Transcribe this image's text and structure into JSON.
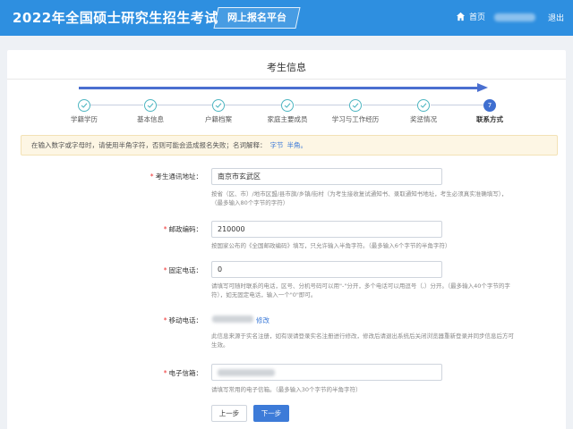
{
  "header": {
    "title": "2022年全国硕士研究生招生考试",
    "platform": "网上报名平台",
    "home": "首页",
    "logout": "退出"
  },
  "page_title": "考生信息",
  "steps": [
    {
      "label": "学籍学历"
    },
    {
      "label": "基本信息"
    },
    {
      "label": "户籍档案"
    },
    {
      "label": "家庭主要成员"
    },
    {
      "label": "学习与工作经历"
    },
    {
      "label": "奖惩情况"
    },
    {
      "label": "联系方式",
      "number": "7"
    }
  ],
  "notice": {
    "text": "在输入数字或字母时，请使用半角字符，否则可能会造成报名失败；名词解释：",
    "link1": "字节",
    "link2": "半角。"
  },
  "fields": {
    "address": {
      "label": "考生通讯地址：",
      "value": "南京市玄武区",
      "hint": "按省（区、市）/地市区盟/县市旗/乡镇/街村（为考生接收复试通知书、录取通知书地址，考生必须真实准确填写），（最多输入80个字节的字符）"
    },
    "postcode": {
      "label": "邮政编码：",
      "value": "210000",
      "hint": "按国家公布的《全国邮政编码》填写，只允许输入半角字符。（最多输入6个字节的半角字符）"
    },
    "phone": {
      "label": "固定电话：",
      "value": "0",
      "hint": "请填写可随时联系的电话，区号、分机号码可以用\"-\"分开，多个电话可以用逗号（,）分开。（最多输入40个字节的字符），如无固定电话，输入一个\"0\"即可。"
    },
    "mobile": {
      "label": "移动电话：",
      "modify": "修改",
      "hint": "此信息来源于实名注册，如有误请登录实名注册进行修改，修改后请退出系统后关闭浏览器重新登录并同步信息后方可生效。"
    },
    "email": {
      "label": "电子信箱：",
      "hint": "请填写常用的电子信箱。（最多输入30个字节的半角字符）"
    }
  },
  "buttons": {
    "prev": "上一步",
    "next": "下一步"
  },
  "colors": {
    "header_bg": "#2e8fe0",
    "accent": "#3d7bd8",
    "progress": "#4a6fd0",
    "step_done": "#4fb6c2",
    "required": "#ee3333"
  }
}
